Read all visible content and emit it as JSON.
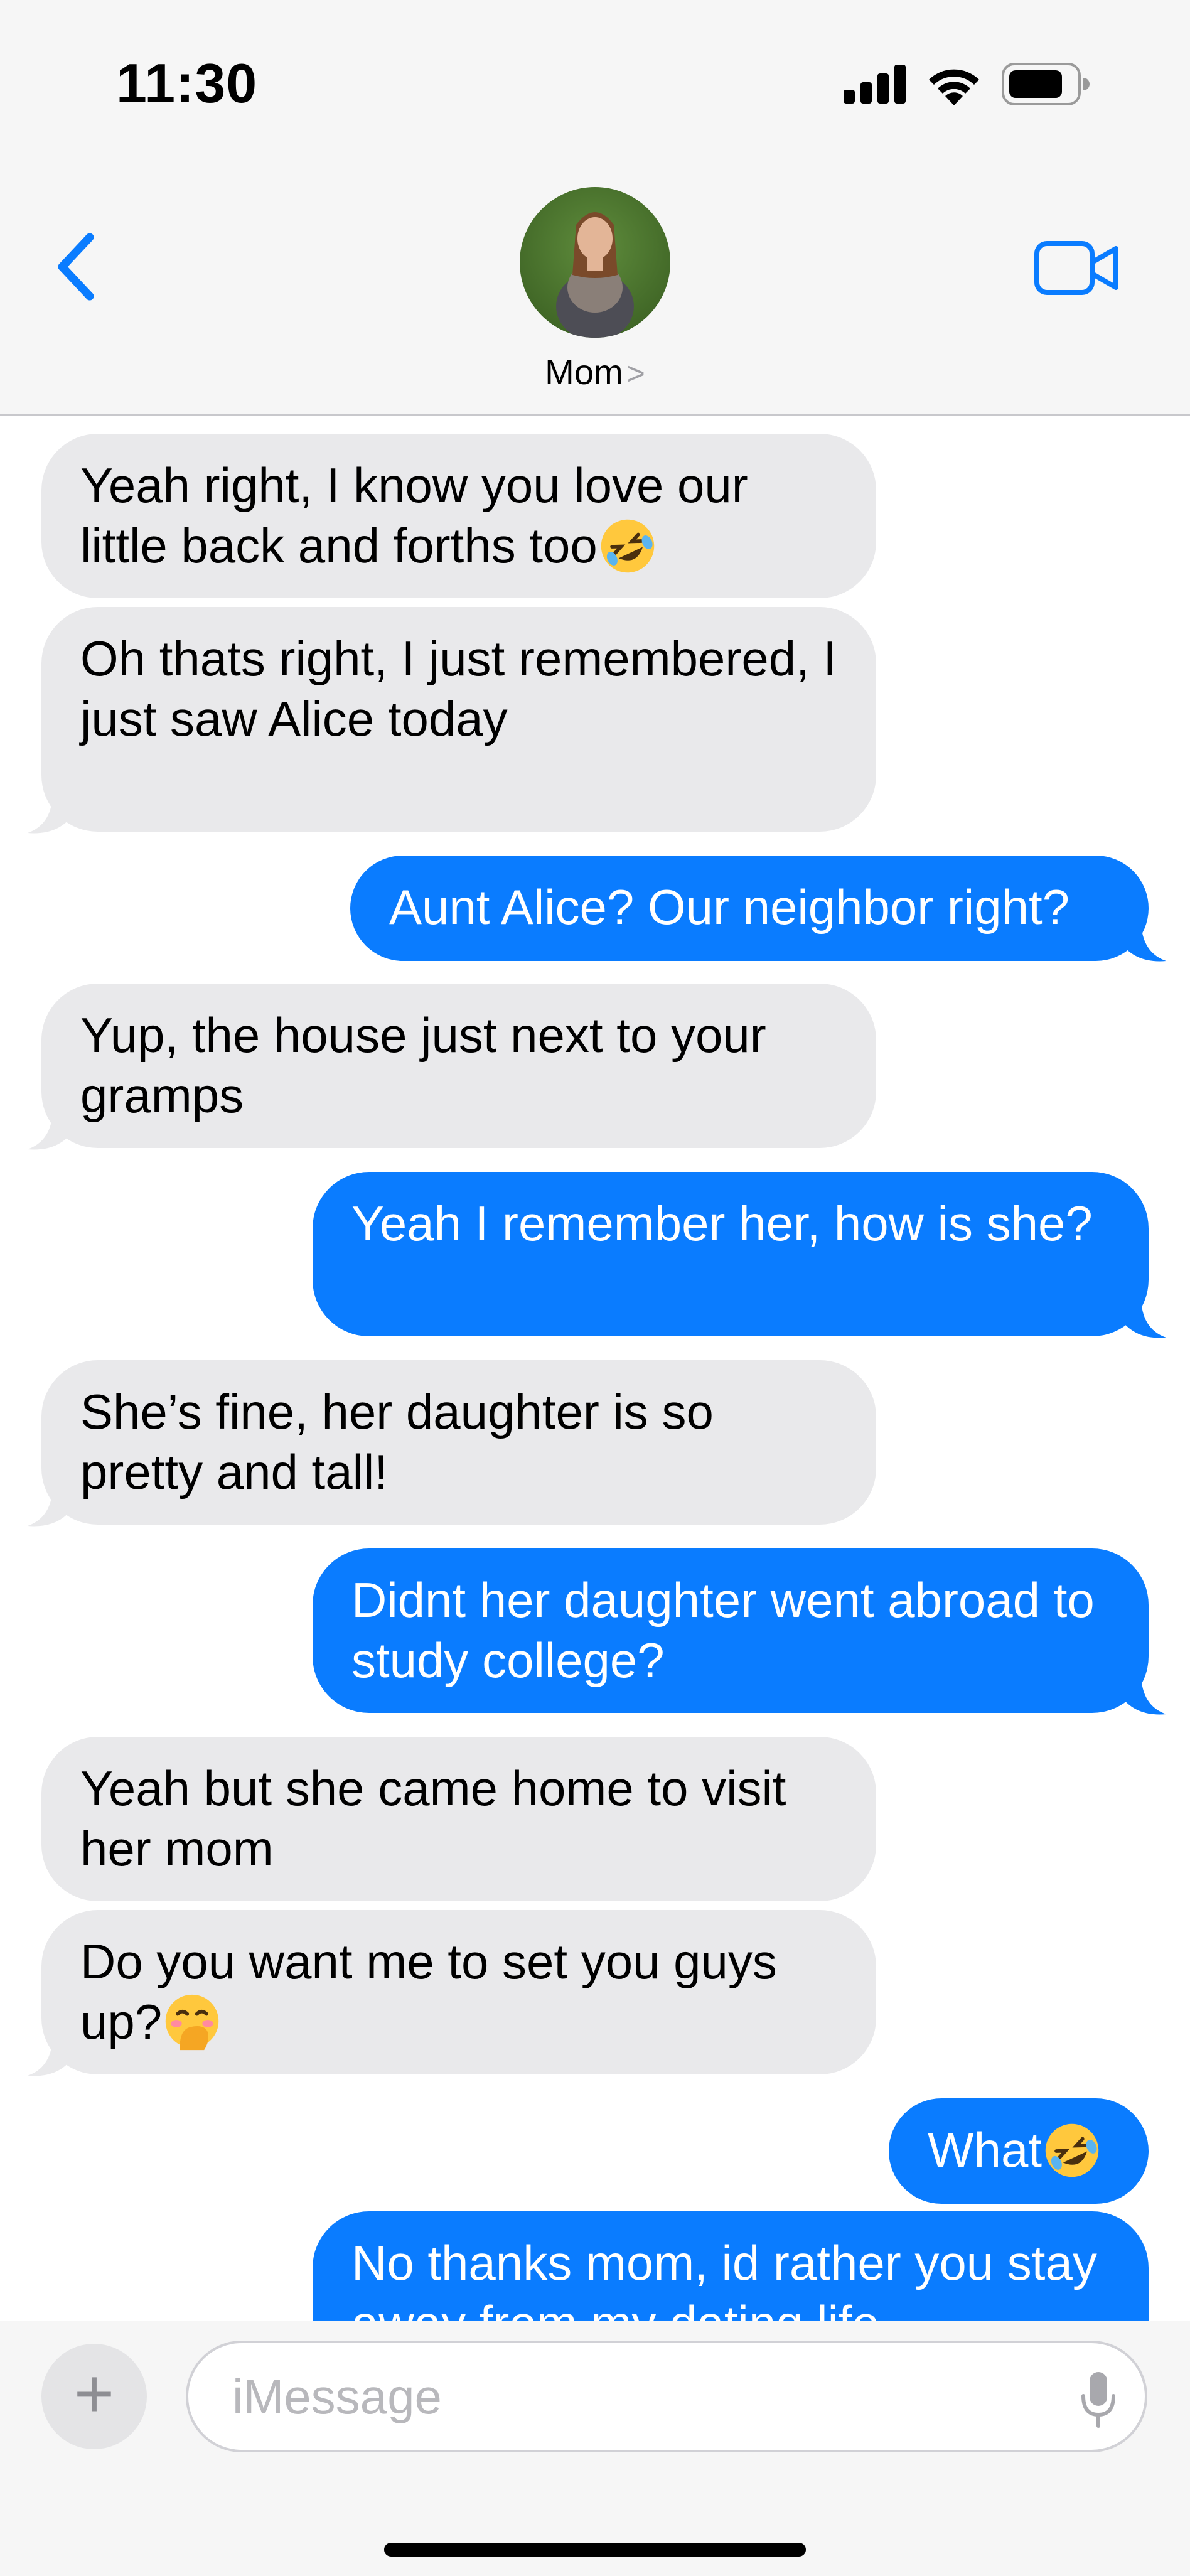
{
  "status_bar": {
    "time": "11:30",
    "icons": [
      "cellular-signal-icon",
      "wifi-icon",
      "battery-icon"
    ]
  },
  "header": {
    "back_icon": "chevron-left-icon",
    "contact_name": "Mom",
    "contact_chevron": ">",
    "video_icon": "video-camera-icon"
  },
  "messages": [
    {
      "from": "them",
      "text": "Yeah right, I know you love our little back and forths too",
      "emoji": "rolling-on-floor-laughing"
    },
    {
      "from": "them",
      "text": "Oh thats right, I just remembered, I just saw Alice today"
    },
    {
      "from": "me",
      "text": "Aunt Alice? Our neighbor right?"
    },
    {
      "from": "them",
      "text": "Yup, the house just next to your gramps"
    },
    {
      "from": "me",
      "text": "Yeah I remember her, how is she?"
    },
    {
      "from": "them",
      "text": "She’s fine, her daughter is so pretty and tall!"
    },
    {
      "from": "me",
      "text": "Didnt her daughter went abroad to study college?"
    },
    {
      "from": "them",
      "text": "Yeah but she came home to visit her mom"
    },
    {
      "from": "them",
      "text": "Do you want me to set you guys up?",
      "emoji": "face-with-hand-over-mouth"
    },
    {
      "from": "me",
      "text": "What",
      "emoji": "rolling-on-floor-laughing"
    },
    {
      "from": "me",
      "text": "No thanks mom, id rather you stay away from my dating life"
    }
  ],
  "input_bar": {
    "plus_label": "+",
    "placeholder": "iMessage",
    "mic_icon": "microphone-icon"
  },
  "colors": {
    "outgoing_bubble": "#0a7cff",
    "incoming_bubble": "#e9e9eb",
    "accent": "#0a7cff",
    "bar_background": "#f6f6f6"
  }
}
